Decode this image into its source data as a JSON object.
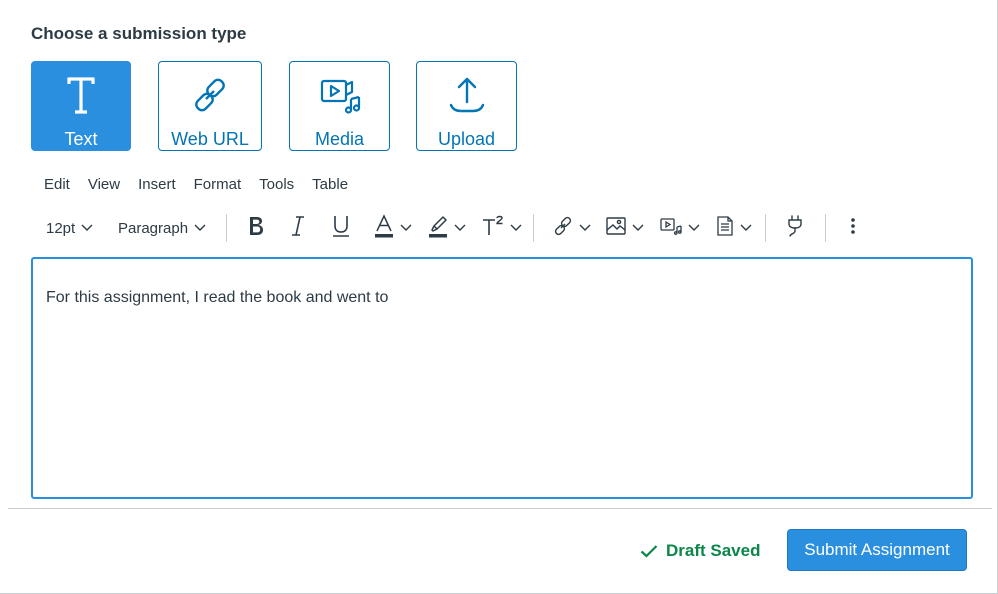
{
  "heading": "Choose a submission type",
  "submission_types": [
    {
      "label": "Text",
      "icon": "text-icon",
      "active": true
    },
    {
      "label": "Web URL",
      "icon": "link-icon",
      "active": false
    },
    {
      "label": "Media",
      "icon": "media-icon",
      "active": false
    },
    {
      "label": "Upload",
      "icon": "upload-icon",
      "active": false
    }
  ],
  "menubar": [
    "Edit",
    "View",
    "Insert",
    "Format",
    "Tools",
    "Table"
  ],
  "toolbar": {
    "font_size": "12pt",
    "block_format": "Paragraph"
  },
  "editor": {
    "content": "For this assignment, I read the book and went to"
  },
  "footer": {
    "draft_status": "Draft Saved",
    "submit_label": "Submit Assignment"
  },
  "colors": {
    "accent": "#2b8fe0",
    "link_blue": "#0374b5",
    "success": "#0b874b",
    "text": "#2d3b45"
  }
}
